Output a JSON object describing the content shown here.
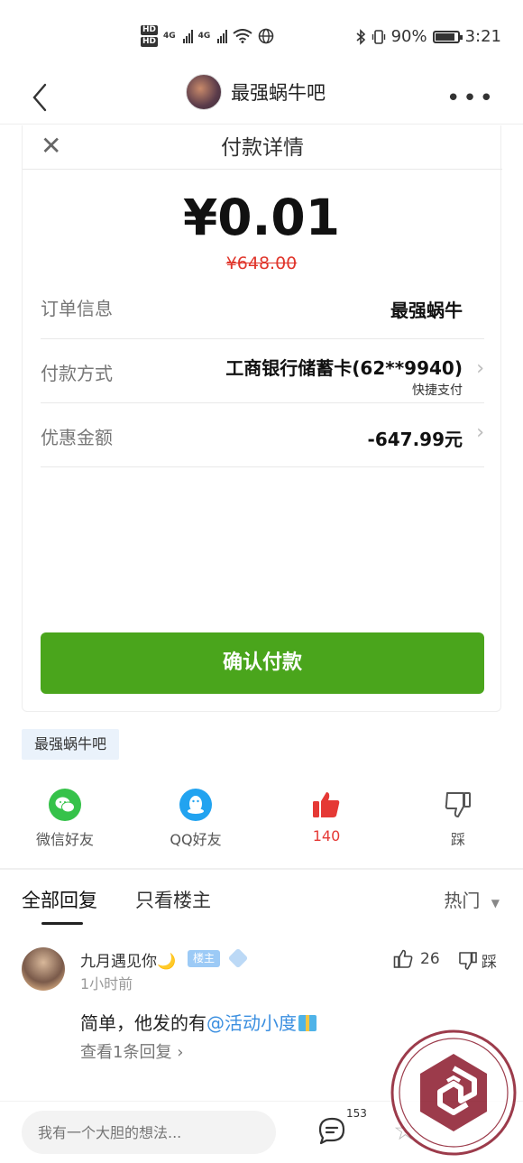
{
  "status_bar": {
    "hd_1": "HD",
    "hd_2": "HD",
    "net_1": "4G",
    "net_2": "4G",
    "battery_percent": "90%",
    "battery_level": 0.9,
    "time": "3:21"
  },
  "nav": {
    "title": "最强蜗牛吧"
  },
  "payment": {
    "title": "付款详情",
    "amount": "¥0.01",
    "original_amount": "¥648.00",
    "rows": [
      {
        "label": "订单信息",
        "value": "最强蜗牛"
      },
      {
        "label": "付款方式",
        "value": "工商银行储蓄卡(62**9940)",
        "sub": "快捷支付"
      },
      {
        "label": "优惠金额",
        "value": "-647.99元"
      }
    ],
    "confirm_label": "确认付款"
  },
  "forum_tag": "最强蜗牛吧",
  "share": {
    "wechat_label": "微信好友",
    "qq_label": "QQ好友",
    "like_count": "140",
    "dislike_label": "踩"
  },
  "tabs": {
    "all": "全部回复",
    "owner_only": "只看楼主",
    "sort": "热门"
  },
  "comment": {
    "name": "九月遇见你🌙",
    "badge": "楼主",
    "time": "1小时前",
    "text_prefix": "简单，他发的有",
    "mention": "@活动小度",
    "replies": "查看1条回复",
    "like_count": "26",
    "dislike_label": "踩"
  },
  "bottom": {
    "placeholder": "我有一个大胆的想法...",
    "comment_count": "153"
  },
  "colors": {
    "confirm_green": "#4aa51c",
    "discount_red": "#e0352b",
    "like_red": "#e53935",
    "mention_blue": "#3b8fe0"
  }
}
